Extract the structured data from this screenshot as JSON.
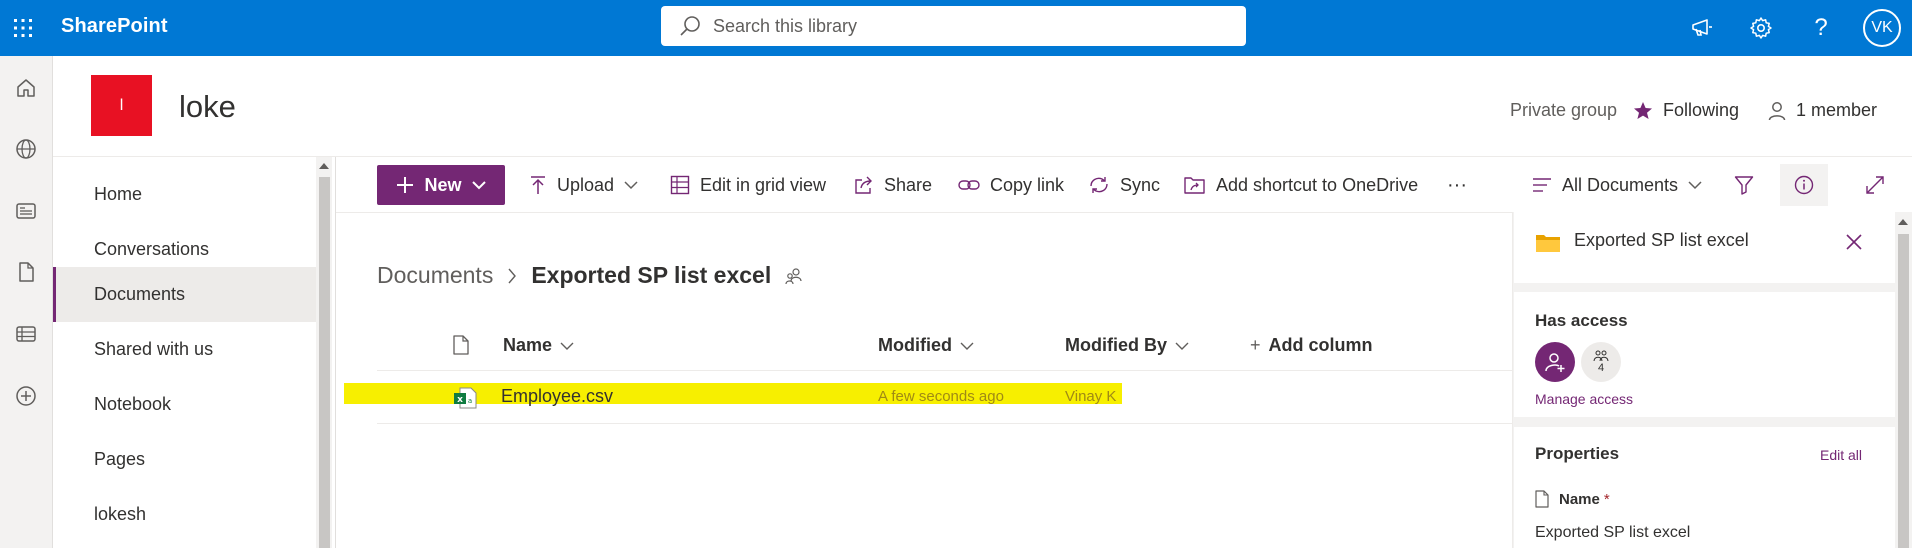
{
  "suite": {
    "app_name": "SharePoint",
    "search_placeholder": "Search this library",
    "user_initials": "VK"
  },
  "site": {
    "logo_letter": "l",
    "title": "loke",
    "group_type": "Private group",
    "following_label": "Following",
    "members_label": "1 member"
  },
  "nav": {
    "items": [
      {
        "label": "Home"
      },
      {
        "label": "Conversations"
      },
      {
        "label": "Documents"
      },
      {
        "label": "Shared with us"
      },
      {
        "label": "Notebook"
      },
      {
        "label": "Pages"
      },
      {
        "label": "lokesh"
      }
    ],
    "active": "Documents"
  },
  "commands": {
    "new": "New",
    "upload": "Upload",
    "grid": "Edit in grid view",
    "share": "Share",
    "copy_link": "Copy link",
    "sync": "Sync",
    "shortcut": "Add shortcut to OneDrive",
    "more": "···",
    "view": "All Documents"
  },
  "breadcrumb": {
    "root": "Documents",
    "current": "Exported SP list excel"
  },
  "list": {
    "columns": {
      "name": "Name",
      "modified": "Modified",
      "modified_by": "Modified By",
      "add": "Add column"
    },
    "rows": [
      {
        "name": "Employee.csv",
        "modified": "A few seconds ago",
        "modified_by": "Vinay K"
      }
    ]
  },
  "details": {
    "title": "Exported SP list excel",
    "has_access": "Has access",
    "group_count": "4",
    "manage_access": "Manage access",
    "properties": "Properties",
    "edit_all": "Edit all",
    "field_name_label": "Name",
    "required_mark": "*",
    "field_name_value": "Exported SP list excel"
  },
  "colors": {
    "suite_blue": "#0078d4",
    "accent_purple": "#742774",
    "highlight_yellow": "#f7ef00",
    "logo_red": "#e81123"
  }
}
